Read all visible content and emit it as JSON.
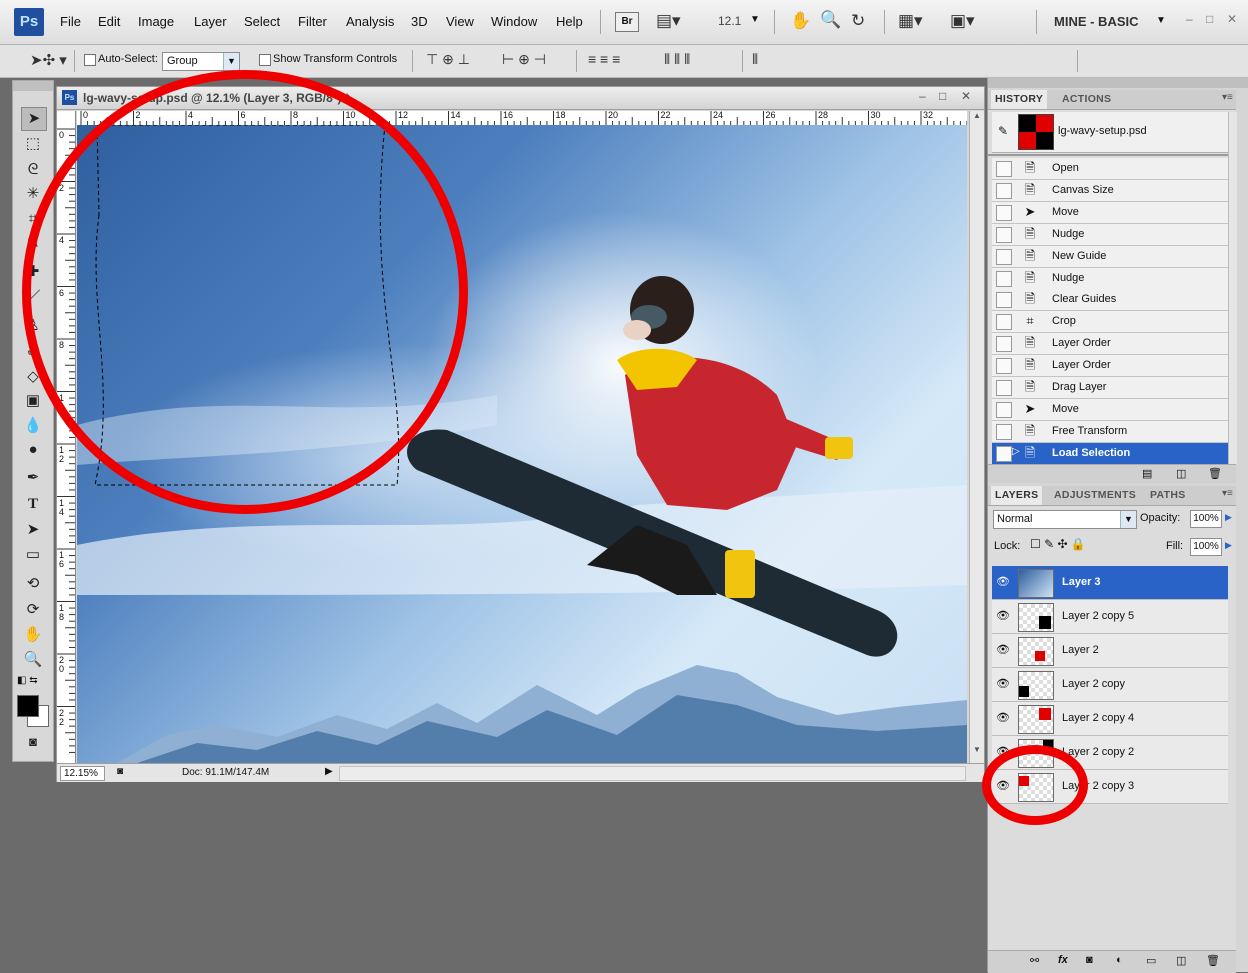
{
  "app": {
    "logo": "Ps",
    "menu": [
      "File",
      "Edit",
      "Image",
      "Layer",
      "Select",
      "Filter",
      "Analysis",
      "3D",
      "View",
      "Window",
      "Help"
    ],
    "bridge_button": "Br",
    "zoom_value": "12.1",
    "workspace": "MINE - BASIC"
  },
  "options_bar": {
    "auto_select_label": "Auto-Select:",
    "auto_select_value": "Group",
    "show_transform_label": "Show Transform Controls"
  },
  "document": {
    "title": "lg-wavy-setup.psd @ 12.1% (Layer 3, RGB/8*) *",
    "zoom_status": "12.15%",
    "doc_size": "Doc: 91.1M/147.4M",
    "ruler_h": [
      "0",
      "2",
      "4",
      "6",
      "8",
      "10",
      "12",
      "14",
      "16",
      "18",
      "20",
      "22",
      "24",
      "26",
      "28",
      "30",
      "32"
    ],
    "ruler_v": [
      "0",
      "2",
      "4",
      "6",
      "8",
      "10",
      "12",
      "14",
      "16",
      "18",
      "20",
      "22"
    ]
  },
  "history_panel": {
    "tabs": [
      "HISTORY",
      "ACTIONS"
    ],
    "snapshot_name": "lg-wavy-setup.psd",
    "items": [
      {
        "label": "Open",
        "icon": "doc-icon"
      },
      {
        "label": "Canvas Size",
        "icon": "doc-icon"
      },
      {
        "label": "Move",
        "icon": "move-icon"
      },
      {
        "label": "Nudge",
        "icon": "doc-icon"
      },
      {
        "label": "New Guide",
        "icon": "doc-icon"
      },
      {
        "label": "Nudge",
        "icon": "doc-icon"
      },
      {
        "label": "Clear Guides",
        "icon": "doc-icon"
      },
      {
        "label": "Crop",
        "icon": "crop-icon"
      },
      {
        "label": "Layer Order",
        "icon": "doc-icon"
      },
      {
        "label": "Layer Order",
        "icon": "doc-icon"
      },
      {
        "label": "Drag Layer",
        "icon": "doc-icon"
      },
      {
        "label": "Move",
        "icon": "move-icon"
      },
      {
        "label": "Free Transform",
        "icon": "doc-icon"
      },
      {
        "label": "Load Selection",
        "icon": "doc-icon",
        "selected": true
      }
    ]
  },
  "layers_panel": {
    "tabs": [
      "LAYERS",
      "ADJUSTMENTS",
      "PATHS"
    ],
    "blend_mode": "Normal",
    "opacity_label": "Opacity:",
    "opacity_value": "100%",
    "lock_label": "Lock:",
    "fill_label": "Fill:",
    "fill_value": "100%",
    "layers": [
      {
        "name": "Layer 3",
        "selected": true
      },
      {
        "name": "Layer 2 copy 5"
      },
      {
        "name": "Layer 2"
      },
      {
        "name": "Layer 2 copy"
      },
      {
        "name": "Layer 2 copy 4"
      },
      {
        "name": "Layer 2 copy 2"
      },
      {
        "name": "Layer 2 copy 3"
      }
    ]
  },
  "colors": {
    "selection_blue": "#2a63c8",
    "annotation_red": "#ee0000"
  }
}
